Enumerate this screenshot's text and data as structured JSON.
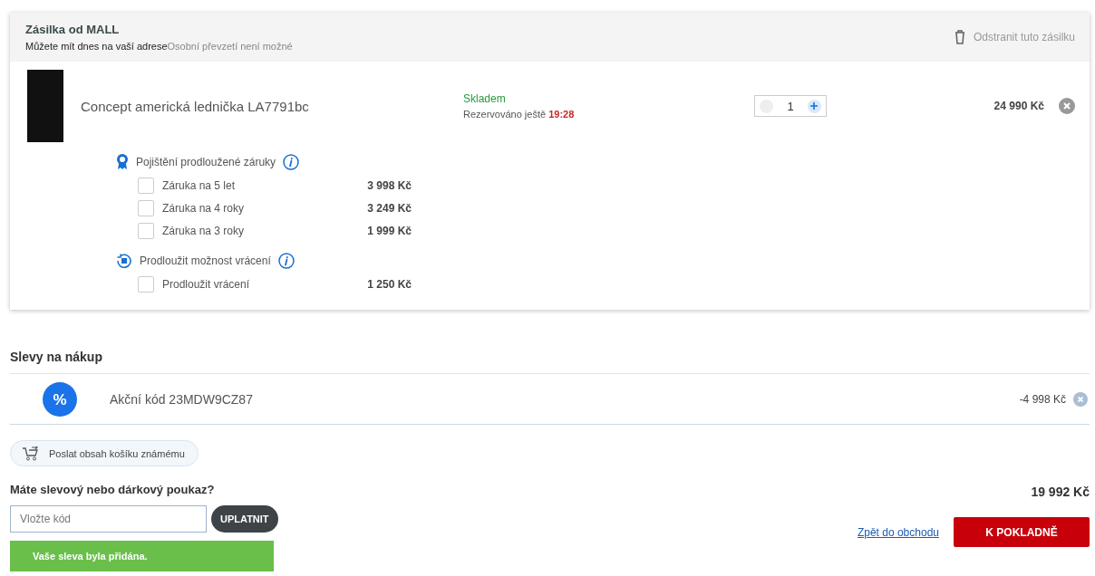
{
  "shipment": {
    "title": "Zásilka od MALL",
    "delivery_note": "Můžete mít dnes na vaší adrese",
    "pickup_note": "Osobní převzetí není možné",
    "remove_label": "Odstranit tuto zásilku",
    "product": {
      "name": "Concept americká lednička LA7791bc",
      "stock": "Skladem",
      "reserved_label": "Rezervováno ještě",
      "reserved_time": "19:28",
      "quantity": "1",
      "price": "24 990 Kč",
      "option_groups": [
        {
          "kind": "warranty",
          "title": "Pojištění prodloužené záruky",
          "options": [
            {
              "label": "Záruka na 5 let",
              "price": "3 998 Kč",
              "checked": false
            },
            {
              "label": "Záruka na 4 roky",
              "price": "3 249 Kč",
              "checked": false
            },
            {
              "label": "Záruka na 3 roky",
              "price": "1 999 Kč",
              "checked": false
            }
          ]
        },
        {
          "kind": "return",
          "title": "Prodloužit možnost vrácení",
          "options": [
            {
              "label": "Prodloužit vrácení",
              "price": "1 250 Kč",
              "checked": false
            }
          ]
        }
      ]
    }
  },
  "discounts": {
    "title": "Slevy na nákup",
    "items": [
      {
        "badge": "%",
        "label": "Akční kód 23MDW9CZ87",
        "amount": "-4 998 Kč"
      }
    ]
  },
  "share_button": "Poslat obsah košíku známému",
  "voucher": {
    "question": "Máte slevový nebo dárkový poukaz?",
    "placeholder": "Vložte kód",
    "apply_button": "UPLATNIT",
    "message": "Vaše sleva byla přidána."
  },
  "total": "19 992 Kč",
  "back_link": "Zpět do obchodu",
  "checkout_button": "K POKLADNĚ"
}
